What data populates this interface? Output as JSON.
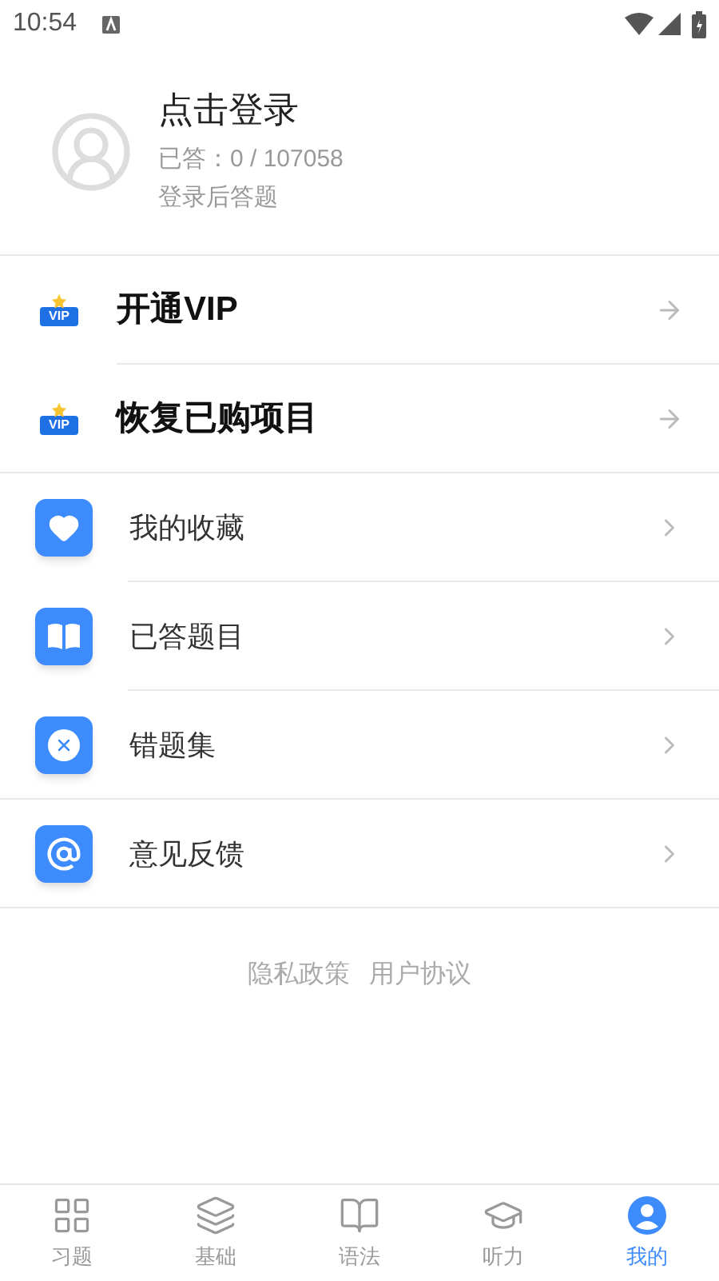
{
  "status_bar": {
    "time": "10:54"
  },
  "profile": {
    "title": "点击登录",
    "answered": "已答：0 / 107058",
    "hint": "登录后答题"
  },
  "vip_items": [
    {
      "label": "开通VIP",
      "badge": "VIP"
    },
    {
      "label": "恢复已购项目",
      "badge": "VIP"
    }
  ],
  "menu_items": [
    {
      "label": "我的收藏"
    },
    {
      "label": "已答题目"
    },
    {
      "label": "错题集"
    },
    {
      "label": "意见反馈"
    }
  ],
  "footer_links": [
    "隐私政策",
    "用户协议"
  ],
  "nav_tabs": [
    {
      "label": "习题",
      "selected": false
    },
    {
      "label": "基础",
      "selected": false
    },
    {
      "label": "语法",
      "selected": false
    },
    {
      "label": "听力",
      "selected": false
    },
    {
      "label": "我的",
      "selected": true
    }
  ]
}
